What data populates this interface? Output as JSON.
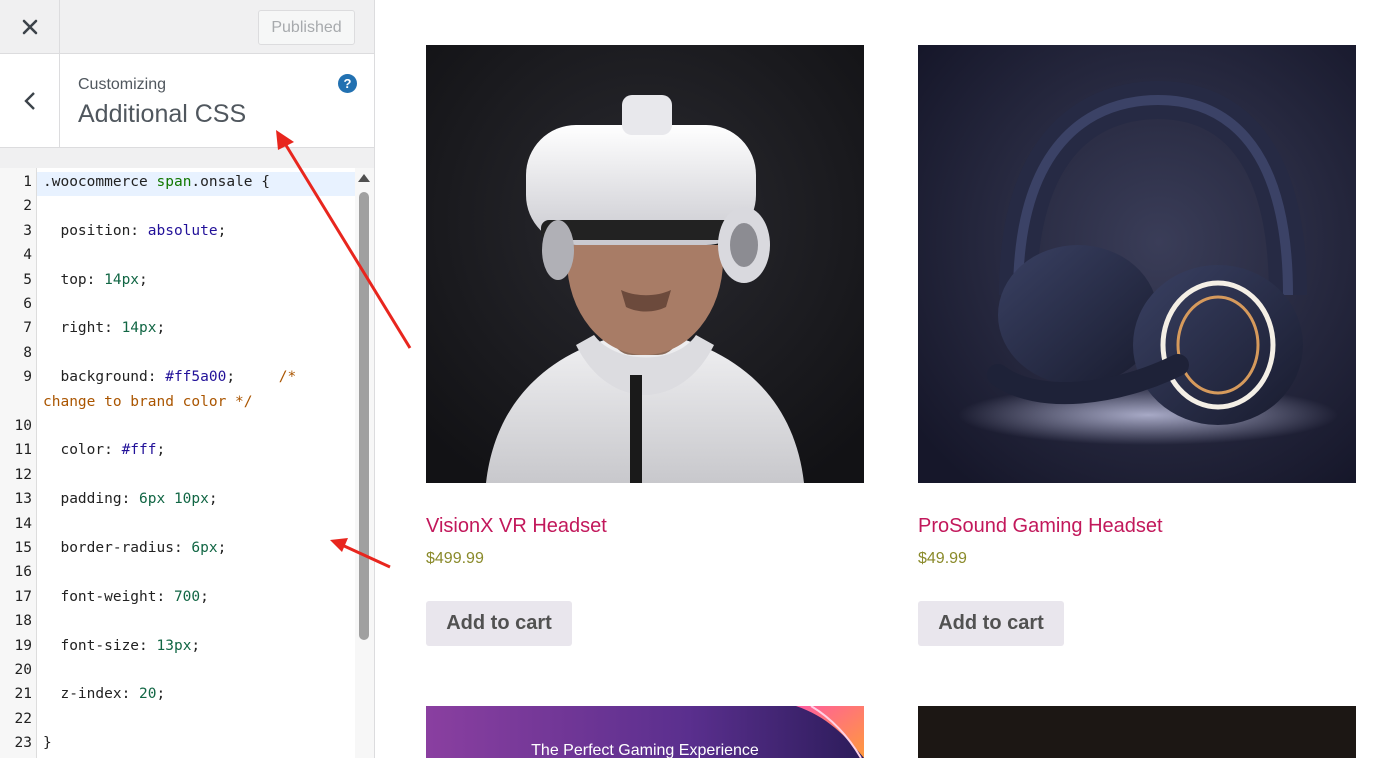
{
  "topbar": {
    "close_icon": "close-icon",
    "publish_label": "Published"
  },
  "section": {
    "customizing_label": "Customizing",
    "title": "Additional CSS",
    "back_icon": "chevron-left-icon",
    "help_icon": "help-icon",
    "help_glyph": "?"
  },
  "editor": {
    "line_numbers": [
      "1",
      "2",
      "3",
      "4",
      "5",
      "6",
      "7",
      "8",
      "9",
      "",
      "10",
      "11",
      "12",
      "13",
      "14",
      "15",
      "16",
      "17",
      "18",
      "19",
      "20",
      "21",
      "22",
      "23"
    ],
    "lines": [
      {
        "segments": [
          {
            "t": ".woocommerce ",
            "c": "prop"
          },
          {
            "t": "span",
            "c": "tag"
          },
          {
            "t": ".onsale {",
            "c": "prop"
          }
        ]
      },
      {
        "segments": []
      },
      {
        "segments": [
          {
            "t": "  position: ",
            "c": "prop"
          },
          {
            "t": "absolute",
            "c": "kw"
          },
          {
            "t": ";",
            "c": "prop"
          }
        ]
      },
      {
        "segments": []
      },
      {
        "segments": [
          {
            "t": "  top: ",
            "c": "prop"
          },
          {
            "t": "14px",
            "c": "num"
          },
          {
            "t": ";",
            "c": "prop"
          }
        ]
      },
      {
        "segments": []
      },
      {
        "segments": [
          {
            "t": "  right: ",
            "c": "prop"
          },
          {
            "t": "14px",
            "c": "num"
          },
          {
            "t": ";",
            "c": "prop"
          }
        ]
      },
      {
        "segments": []
      },
      {
        "segments": [
          {
            "t": "  background: ",
            "c": "prop"
          },
          {
            "t": "#ff5a00",
            "c": "kw"
          },
          {
            "t": ";     ",
            "c": "prop"
          },
          {
            "t": "/*",
            "c": "com"
          }
        ]
      },
      {
        "segments": [
          {
            "t": "change to brand color */",
            "c": "com"
          }
        ]
      },
      {
        "segments": []
      },
      {
        "segments": [
          {
            "t": "  color: ",
            "c": "prop"
          },
          {
            "t": "#fff",
            "c": "kw"
          },
          {
            "t": ";",
            "c": "prop"
          }
        ]
      },
      {
        "segments": []
      },
      {
        "segments": [
          {
            "t": "  padding: ",
            "c": "prop"
          },
          {
            "t": "6px 10px",
            "c": "num"
          },
          {
            "t": ";",
            "c": "prop"
          }
        ]
      },
      {
        "segments": []
      },
      {
        "segments": [
          {
            "t": "  border-radius: ",
            "c": "prop"
          },
          {
            "t": "6px",
            "c": "num"
          },
          {
            "t": ";",
            "c": "prop"
          }
        ]
      },
      {
        "segments": []
      },
      {
        "segments": [
          {
            "t": "  font-weight: ",
            "c": "prop"
          },
          {
            "t": "700",
            "c": "num"
          },
          {
            "t": ";",
            "c": "prop"
          }
        ]
      },
      {
        "segments": []
      },
      {
        "segments": [
          {
            "t": "  font-size: ",
            "c": "prop"
          },
          {
            "t": "13px",
            "c": "num"
          },
          {
            "t": ";",
            "c": "prop"
          }
        ]
      },
      {
        "segments": []
      },
      {
        "segments": [
          {
            "t": "  z-index: ",
            "c": "prop"
          },
          {
            "t": "20",
            "c": "num"
          },
          {
            "t": ";",
            "c": "prop"
          }
        ]
      },
      {
        "segments": []
      },
      {
        "segments": [
          {
            "t": "}",
            "c": "prop"
          }
        ]
      }
    ]
  },
  "products": [
    {
      "name": "VisionX VR Headset",
      "price": "$499.99",
      "button": "Add to cart",
      "image": "vr-headset-photo"
    },
    {
      "name": "ProSound Gaming Headset",
      "price": "$49.99",
      "button": "Add to cart",
      "image": "gaming-headset-photo"
    }
  ],
  "banner": {
    "text": "The Perfect Gaming Experience"
  },
  "colors": {
    "accent": "#2271b1",
    "product_title": "#c2185b",
    "price": "#8a8a2a",
    "annotation_arrow": "#e8261e"
  }
}
